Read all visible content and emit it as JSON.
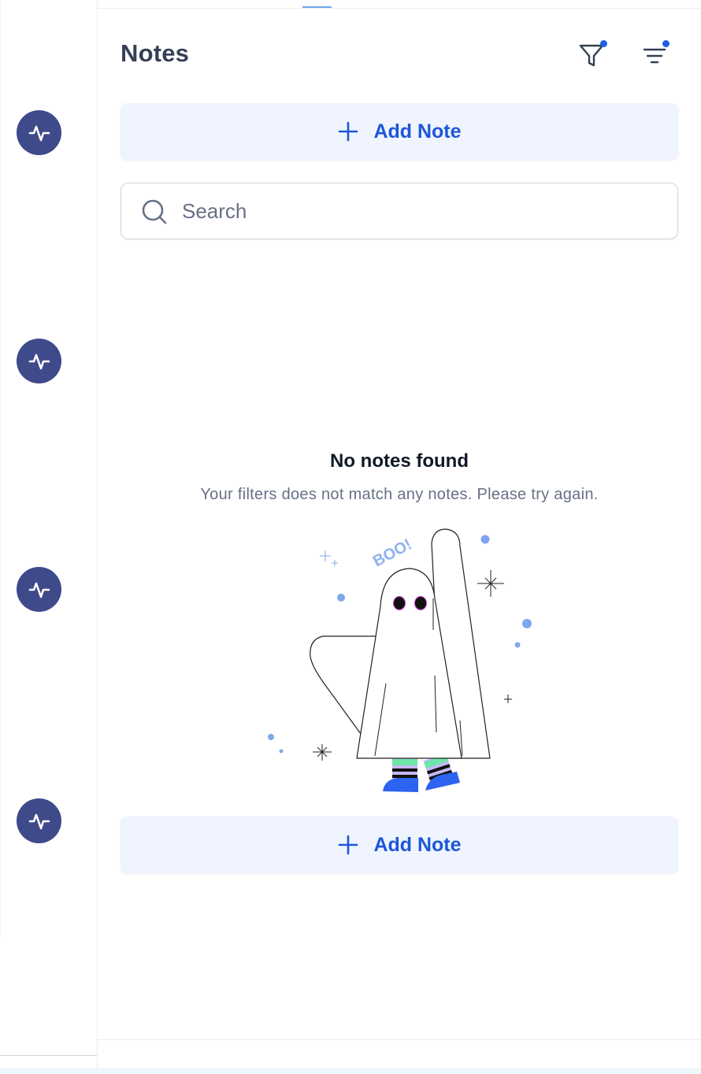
{
  "panel": {
    "title": "Notes",
    "filter_icon": "filter-icon",
    "sort_icon": "sort-lines-icon",
    "accent_color": "#1d56d8"
  },
  "add_note_top": {
    "label": "Add Note",
    "icon": "plus-icon"
  },
  "search": {
    "placeholder": "Search",
    "value": "",
    "icon": "search-icon"
  },
  "empty_state": {
    "title": "No notes found",
    "subtitle": "Your filters does not match any notes. Please try again.",
    "illustration_text": "BOO!"
  },
  "add_note_bottom": {
    "label": "Add Note",
    "icon": "plus-icon"
  },
  "left_rail": {
    "icons": [
      "activity-icon",
      "activity-icon",
      "activity-icon",
      "activity-icon"
    ],
    "icon_color": "#3f4a8a"
  }
}
